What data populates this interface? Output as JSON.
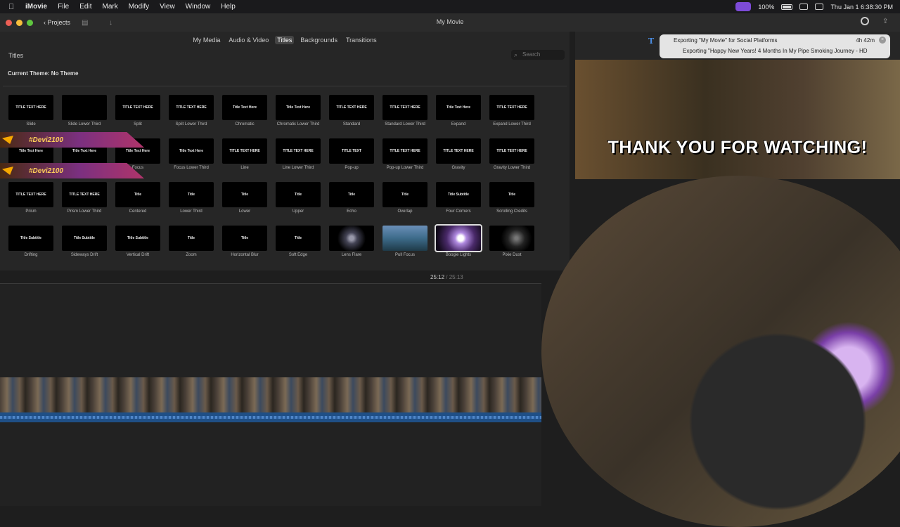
{
  "menubar": {
    "apple": "",
    "items": [
      "iMovie",
      "File",
      "Edit",
      "Mark",
      "Modify",
      "View",
      "Window",
      "Help"
    ],
    "battery": "100%",
    "datetime": "Thu Jan 1  6:38:30 PM"
  },
  "toolbar": {
    "projects_label": "Projects",
    "window_title": "My Movie"
  },
  "browser": {
    "tabs": [
      {
        "label": "My Media",
        "active": false
      },
      {
        "label": "Audio & Video",
        "active": false
      },
      {
        "label": "Titles",
        "active": true
      },
      {
        "label": "Backgrounds",
        "active": false
      },
      {
        "label": "Transitions",
        "active": false
      }
    ],
    "section_title": "Titles",
    "search_placeholder": "Search",
    "theme": "Current Theme: No Theme",
    "titles": [
      {
        "name": "Slide",
        "thumb": "TITLE TEXT HERE"
      },
      {
        "name": "Slide Lower Third",
        "thumb": ""
      },
      {
        "name": "Split",
        "thumb": "TITLE TEXT HERE"
      },
      {
        "name": "Split Lower Third",
        "thumb": "TITLE TEXT HERE"
      },
      {
        "name": "Chromatic",
        "thumb": "Title Text Here"
      },
      {
        "name": "Chromatic Lower Third",
        "thumb": "Title Text Here"
      },
      {
        "name": "Standard",
        "thumb": "TITLE TEXT HERE"
      },
      {
        "name": "Standard Lower Third",
        "thumb": "TITLE TEXT HERE"
      },
      {
        "name": "Expand",
        "thumb": "Title Text Here"
      },
      {
        "name": "Expand Lower Third",
        "thumb": "TITLE TEXT HERE"
      },
      {
        "name": "Focus",
        "thumb": "Title Text Here"
      },
      {
        "name": "Focus",
        "thumb": "Title Text Here"
      },
      {
        "name": "Focus",
        "thumb": "Title Text Here"
      },
      {
        "name": "Focus Lower Third",
        "thumb": "Title Text Here"
      },
      {
        "name": "Line",
        "thumb": "TITLE TEXT HERE"
      },
      {
        "name": "Line Lower Third",
        "thumb": "TITLE TEXT HERE"
      },
      {
        "name": "Pop-up",
        "thumb": "TITLE TEXT"
      },
      {
        "name": "Pop-up Lower Third",
        "thumb": "TITLE TEXT HERE"
      },
      {
        "name": "Gravity",
        "thumb": "TITLE TEXT HERE"
      },
      {
        "name": "Gravity Lower Third",
        "thumb": "TITLE TEXT HERE"
      },
      {
        "name": "Prism",
        "thumb": "TITLE TEXT HERE"
      },
      {
        "name": "Prism Lower Third",
        "thumb": "TITLE TEXT HERE"
      },
      {
        "name": "Centered",
        "thumb": "Title"
      },
      {
        "name": "Lower Third",
        "thumb": "Title"
      },
      {
        "name": "Lower",
        "thumb": "Title"
      },
      {
        "name": "Upper",
        "thumb": "Title"
      },
      {
        "name": "Echo",
        "thumb": "Title"
      },
      {
        "name": "Overlap",
        "thumb": "Title"
      },
      {
        "name": "Four Corners",
        "thumb": "Title Subtitle"
      },
      {
        "name": "Scrolling Credits",
        "thumb": "Title"
      },
      {
        "name": "Drifting",
        "thumb": "Title Subtitle"
      },
      {
        "name": "Sideways Drift",
        "thumb": "Title Subtitle"
      },
      {
        "name": "Vertical Drift",
        "thumb": "Title Subtitle"
      },
      {
        "name": "Zoom",
        "thumb": "Title"
      },
      {
        "name": "Horizontal Blur",
        "thumb": "Title"
      },
      {
        "name": "Soft Edge",
        "thumb": "Title"
      },
      {
        "name": "Lens Flare",
        "thumb": ""
      },
      {
        "name": "Pull Focus",
        "thumb": ""
      },
      {
        "name": "Boogie Lights",
        "thumb": ""
      },
      {
        "name": "Pixie Dust",
        "thumb": ""
      }
    ]
  },
  "overlay": {
    "handle": "#Devi2100"
  },
  "timeline": {
    "current": "25:12",
    "separator": "/",
    "total": "25:13"
  },
  "viewer": {
    "caption": "THANK YOU FOR WATCHING!"
  },
  "export": {
    "line1": "Exporting \"My Movie\" for Social Platforms",
    "time": "4h 42m",
    "line2": "Exporting \"Happy New Years! 4 Months In My Pipe Smoking Journey - HD"
  }
}
